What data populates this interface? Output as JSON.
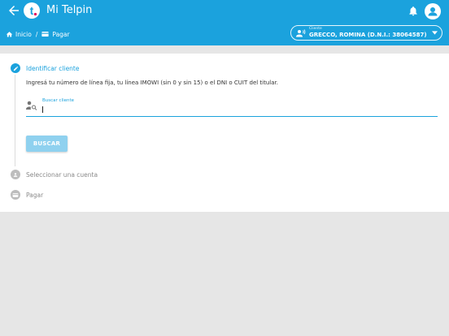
{
  "colors": {
    "primary": "#1ba2dd",
    "button_disabled": "#8fd1ef",
    "step_inactive": "#bdbdbd",
    "background": "#e6e6e6"
  },
  "header": {
    "back_icon": "arrow-left-icon",
    "logo_letter": "t",
    "title": "Mi Telpin",
    "notifications_icon": "bell-icon",
    "account_icon": "user-avatar-icon"
  },
  "breadcrumb": {
    "home_label": "Inicio",
    "separator": "/",
    "current_label": "Pagar"
  },
  "client_selector": {
    "caption": "Cliente",
    "name": "GRECCO, ROMINA (D.N.I.: 38064587)"
  },
  "steps": [
    {
      "label": "Identificar cliente",
      "icon": "pencil-icon",
      "active": true
    },
    {
      "label": "Seleccionar una cuenta",
      "icon": "account-icon",
      "active": false
    },
    {
      "label": "Pagar",
      "icon": "payment-icon",
      "active": false
    }
  ],
  "identify": {
    "instructions": "Ingresá tu número de línea fija, tu línea IMOWI (sin 0 y sin 15) o el DNI o CUIT del titular.",
    "search_label": "Buscar cliente",
    "search_value": "",
    "search_button": "BUSCAR"
  }
}
